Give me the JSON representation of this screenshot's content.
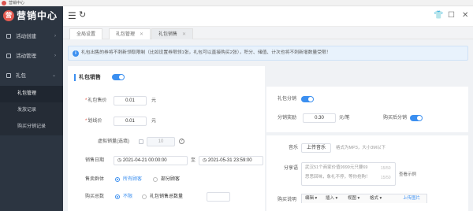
{
  "window": {
    "title": "营销中心"
  },
  "brand": {
    "name": "营销中心"
  },
  "sidebar": {
    "items": [
      {
        "label": "活动创建",
        "chevron": "›"
      },
      {
        "label": "活动管理",
        "chevron": "›"
      },
      {
        "label": "礼包",
        "chevron": "⌄"
      }
    ],
    "subitems": [
      {
        "label": "礼包管理"
      },
      {
        "label": "发放记录"
      },
      {
        "label": "购买分销记录"
      }
    ]
  },
  "topbar": {
    "menu_icon": "☰",
    "refresh_icon": "↻",
    "shirt_icon": "👕",
    "message_icon": "☐",
    "close_icon": "✕"
  },
  "tabs": [
    {
      "label": "全局设置"
    },
    {
      "label": "礼包管理"
    },
    {
      "label": "礼包销售"
    }
  ],
  "tab_close": "✕",
  "notice": {
    "icon": "i",
    "text": "礼包出售的券将不刺新领取限制（比如设置券限领1张，礼包可以直接购买2张），积分、储值、计次也将不刺新增数量受限！"
  },
  "sale": {
    "title": "礼包销售",
    "price_label": "礼包售价",
    "price_value": "0.01",
    "price_unit": "元",
    "orig_label": "划线价",
    "orig_value": "0.01",
    "orig_unit": "元",
    "virtual_label": "虚拟销量(选填)",
    "virtual_value": "10",
    "date_label": "销售日期",
    "date_start": "2021-04-21 00:00:00",
    "date_sep": "至",
    "date_end": "2021-05-31 23:59:00",
    "group_label": "售卖群体",
    "group_opt1": "所有顾客",
    "group_opt2": "部分顾客",
    "total_label": "购买总数",
    "total_opt1": "不限",
    "total_opt2": "礼包销售总数量"
  },
  "distribution": {
    "gift_label": "礼包分销",
    "reward_label": "分销奖励",
    "reward_value": "0.30",
    "reward_unit": "元/笔",
    "buy_label": "购买后分销"
  },
  "media": {
    "music_label": "音乐",
    "upload_btn": "上传音乐",
    "music_hint": "格式为MP3，大小3M以下",
    "share_label": "分享语",
    "share_line1": "武汉51个商家价值9999元只要69",
    "share_line2": "思思回味，象礼不停，等你抢购！",
    "share_count1": "15/50",
    "share_count2": "15/50",
    "example_link": "查看示例",
    "desc_label": "购买说明",
    "tb_edit": "编辑",
    "tb_insert": "插入",
    "tb_view": "视图",
    "tb_format": "格式",
    "tb_upload": "上传图片"
  }
}
